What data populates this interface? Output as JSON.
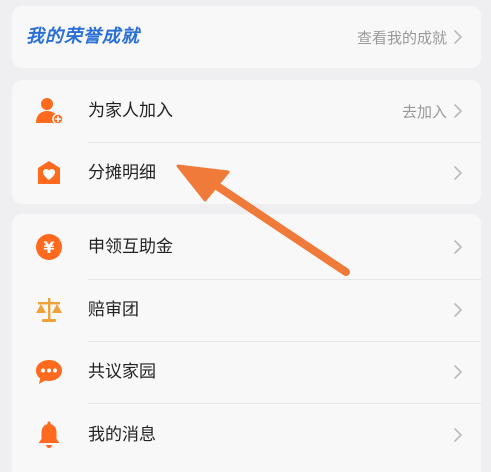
{
  "honor": {
    "title": "我的荣誉成就",
    "link": "查看我的成就"
  },
  "family": {
    "items": [
      {
        "label": "为家人加入",
        "right": "去加入",
        "icon": "user-add-icon"
      },
      {
        "label": "分摊明细",
        "right": "",
        "icon": "shield-heart-icon"
      }
    ]
  },
  "menu": {
    "items": [
      {
        "label": "申领互助金",
        "icon": "yuan-coin-icon"
      },
      {
        "label": "赔审团",
        "icon": "scale-icon"
      },
      {
        "label": "共议家园",
        "icon": "chat-bubble-icon"
      },
      {
        "label": "我的消息",
        "icon": "bell-icon"
      }
    ]
  },
  "colors": {
    "accent": "#ff6a1f",
    "title_blue": "#2a6fd6",
    "arrow": "#f07a3a"
  }
}
